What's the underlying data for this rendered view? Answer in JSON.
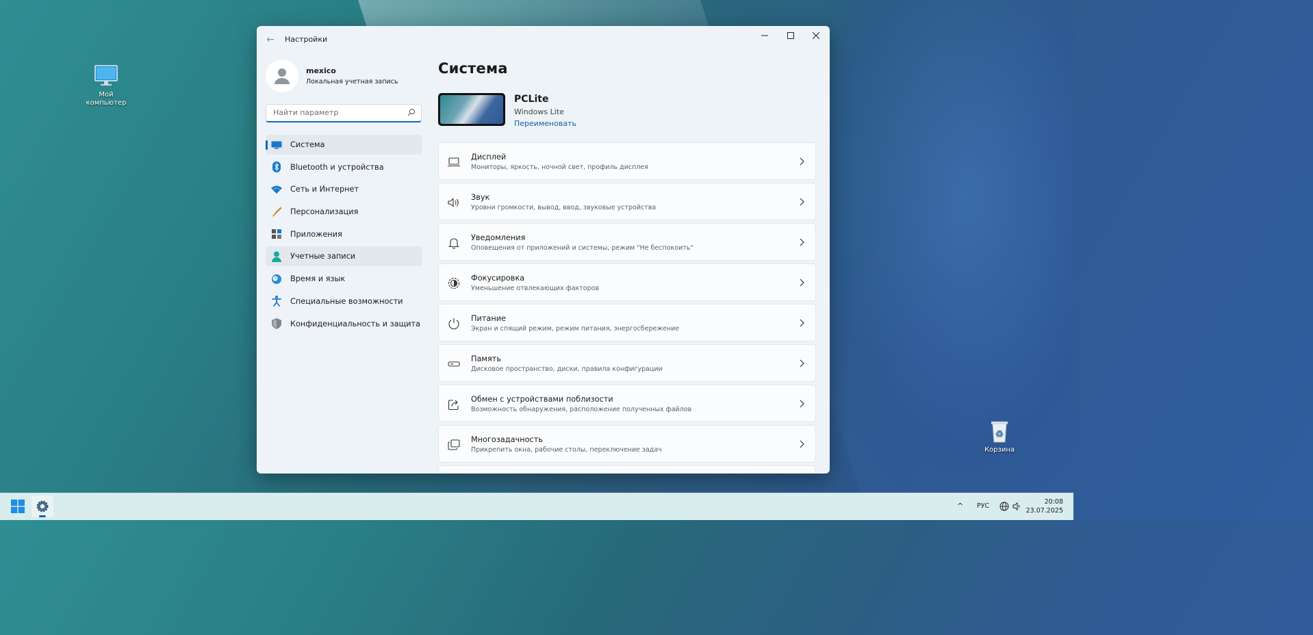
{
  "desktop": {
    "icons": [
      {
        "label": "Мой компьютер"
      },
      {
        "label": "Корзина"
      }
    ]
  },
  "window": {
    "title": "Настройки",
    "back_label": "←",
    "minimize": "—",
    "maximize": "☐",
    "close": "✕"
  },
  "profile": {
    "name": "mexico",
    "account_type": "Локальная учетная запись"
  },
  "search": {
    "placeholder": "Найти параметр"
  },
  "nav": {
    "items": [
      {
        "label": "Система",
        "icon": "monitor-icon"
      },
      {
        "label": "Bluetooth и устройства",
        "icon": "bluetooth-icon"
      },
      {
        "label": "Сеть и Интернет",
        "icon": "wifi-icon"
      },
      {
        "label": "Персонализация",
        "icon": "brush-icon"
      },
      {
        "label": "Приложения",
        "icon": "apps-icon"
      },
      {
        "label": "Учетные записи",
        "icon": "person-icon"
      },
      {
        "label": "Время и язык",
        "icon": "globe-clock-icon"
      },
      {
        "label": "Специальные возможности",
        "icon": "accessibility-icon"
      },
      {
        "label": "Конфиденциальность и защита",
        "icon": "shield-icon"
      }
    ]
  },
  "main": {
    "title": "Система",
    "device": {
      "name": "PCLite",
      "os": "Windows Lite",
      "rename_link": "Переименовать"
    },
    "cards": [
      {
        "title": "Дисплей",
        "subtitle": "Мониторы, яркость, ночной свет, профиль дисплея",
        "icon": "display-icon"
      },
      {
        "title": "Звук",
        "subtitle": "Уровни громкости, вывод, ввод, звуковые устройства",
        "icon": "speaker-icon"
      },
      {
        "title": "Уведомления",
        "subtitle": "Оповещения от приложений и системы, режим \"Не беспокоить\"",
        "icon": "bell-icon"
      },
      {
        "title": "Фокусировка",
        "subtitle": "Уменьшение отвлекающих факторов",
        "icon": "focus-icon"
      },
      {
        "title": "Питание",
        "subtitle": "Экран и спящий режим, режим питания, энергосбережение",
        "icon": "power-icon"
      },
      {
        "title": "Память",
        "subtitle": "Дисковое пространство, диски, правила конфигурации",
        "icon": "storage-icon"
      },
      {
        "title": "Обмен с устройствами поблизости",
        "subtitle": "Возможность обнаружения, расположение полученных файлов",
        "icon": "share-icon"
      },
      {
        "title": "Многозадачность",
        "subtitle": "Прикрепить окна, рабочие столы, переключение задач",
        "icon": "multitask-icon"
      }
    ]
  },
  "taskbar": {
    "tray_chevron": "^",
    "language": "РУС",
    "time": "20:08",
    "date": "23.07.2025"
  }
}
